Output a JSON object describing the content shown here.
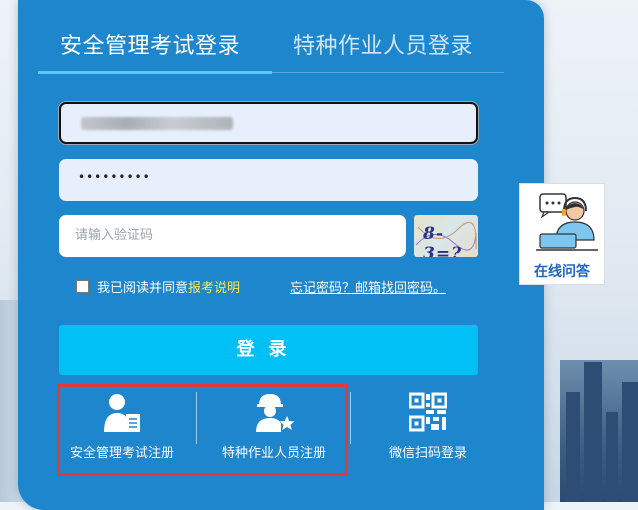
{
  "tabs": {
    "active_label": "安全管理考试登录",
    "inactive_label": "特种作业人员登录"
  },
  "form": {
    "password_value": "•••••••••",
    "captcha_placeholder": "请输入验证码",
    "captcha_text": "8-3=?"
  },
  "agree": {
    "prefix": "我已阅读并同意",
    "link": "报考说明"
  },
  "forgot_link": "忘记密码？邮箱找回密码。",
  "login_button": "登录",
  "register": {
    "safety_label": "安全管理考试注册",
    "special_label": "特种作业人员注册",
    "wechat_label": "微信扫码登录"
  },
  "side_help": {
    "label": "在线问答"
  },
  "colors": {
    "panel": "#1e86cc",
    "login_button": "#00c0f5",
    "highlight_link": "#ffe94a",
    "register_box_border": "#e53935"
  },
  "icons": [
    "safety-register-person-icon",
    "worker-star-icon",
    "qr-code-icon",
    "customer-service-icon"
  ]
}
